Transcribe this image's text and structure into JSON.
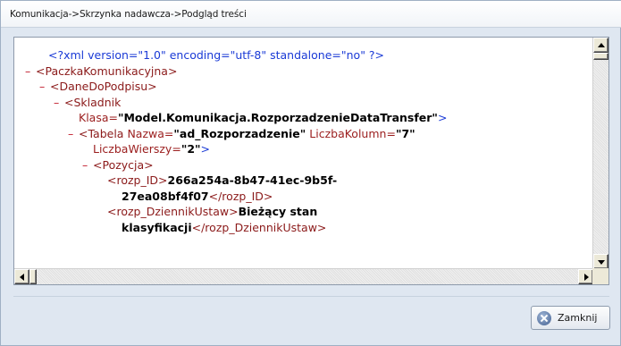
{
  "window": {
    "title": "Komunikacja->Skrzynka nadawcza->Podgląd treści"
  },
  "xml": {
    "lines": [
      {
        "minus": "",
        "parts": [
          {
            "cls": "pi",
            "text": "<?xml version=\"1.0\" encoding=\"utf-8\" standalone=\"no\" ?>"
          }
        ]
      },
      {
        "minus": "–",
        "parts": [
          {
            "cls": "tag",
            "text": "<PaczkaKomunikacyjna>"
          }
        ]
      },
      {
        "minus": "–",
        "parts": [
          {
            "cls": "tag",
            "text": "<DaneDoPodpisu>"
          }
        ]
      },
      {
        "minus": "–",
        "parts": [
          {
            "cls": "tag",
            "text": "<Skladnik"
          }
        ]
      },
      {
        "minus": "",
        "parts": [
          {
            "cls": "attr",
            "text": "Klasa="
          },
          {
            "cls": "val",
            "text": "\"Model.Komunikacja.RozporzadzenieDataTransfer\""
          },
          {
            "cls": "blue",
            "text": ">"
          }
        ]
      },
      {
        "minus": "–",
        "parts": [
          {
            "cls": "tag",
            "text": "<Tabela "
          },
          {
            "cls": "attr",
            "text": "Nazwa="
          },
          {
            "cls": "val",
            "text": "\"ad_Rozporzadzenie\""
          },
          {
            "cls": "attr",
            "text": " LiczbaKolumn="
          },
          {
            "cls": "val",
            "text": "\"7\""
          }
        ]
      },
      {
        "minus": "",
        "parts": [
          {
            "cls": "attr",
            "text": "LiczbaWierszy="
          },
          {
            "cls": "val",
            "text": "\"2\""
          },
          {
            "cls": "blue",
            "text": ">"
          }
        ]
      },
      {
        "minus": "–",
        "parts": [
          {
            "cls": "tag",
            "text": "<Pozycja>"
          }
        ]
      },
      {
        "minus": "",
        "parts": [
          {
            "cls": "tag",
            "text": "<rozp_ID>"
          },
          {
            "cls": "val",
            "text": "266a254a-8b47-41ec-9b5f-"
          }
        ]
      },
      {
        "minus": "",
        "parts": [
          {
            "cls": "val",
            "text": "27ea08bf4f07"
          },
          {
            "cls": "tag",
            "text": "</rozp_ID>"
          }
        ]
      },
      {
        "minus": "",
        "parts": [
          {
            "cls": "tag",
            "text": "<rozp_DziennikUstaw>"
          },
          {
            "cls": "val",
            "text": "Bieżący stan"
          }
        ]
      },
      {
        "minus": "",
        "parts": [
          {
            "cls": "val",
            "text": "klasyfikacji"
          },
          {
            "cls": "tag",
            "text": "</rozp_DziennikUstaw>"
          }
        ]
      }
    ]
  },
  "buttons": {
    "close_label": "Zamknij"
  },
  "icons": {
    "close": "close-circle-icon"
  }
}
